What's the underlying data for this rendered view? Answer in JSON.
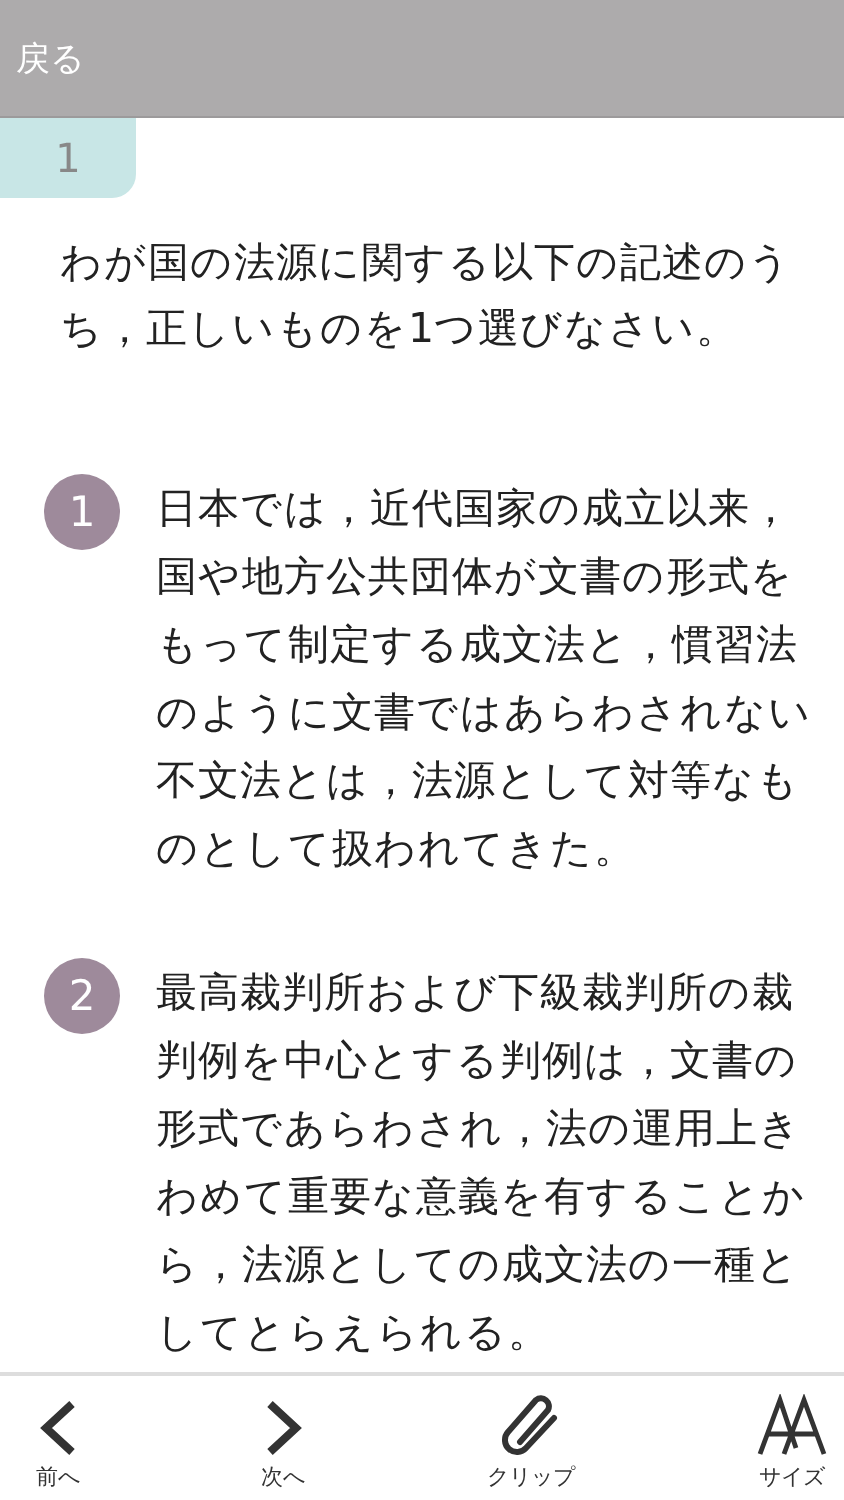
{
  "header": {
    "back": "戻る"
  },
  "question_tab": {
    "number": "1"
  },
  "question": "わが国の法源に関する以下の記述のうち，正しいものを1つ選びなさい。",
  "options": [
    {
      "number": "1",
      "text": "日本では，近代国家の成立以来，国や地方公共団体が文書の形式をもって制定する成文法と，慣習法のように文書ではあらわされない不文法とは，法源として対等なものとして扱われてきた。"
    },
    {
      "number": "2",
      "text": "最高裁判所および下級裁判所の裁判例を中心とする判例は，文書の形式であらわされ，法の運用上きわめて重要な意義を有することから，法源としての成文法の一種としてとらえられる。"
    }
  ],
  "toolbar": [
    {
      "kind": "prev",
      "label": "前へ"
    },
    {
      "kind": "next",
      "label": "次へ"
    },
    {
      "kind": "clip",
      "label": "クリップ"
    },
    {
      "kind": "size",
      "label": "サイズ"
    }
  ]
}
